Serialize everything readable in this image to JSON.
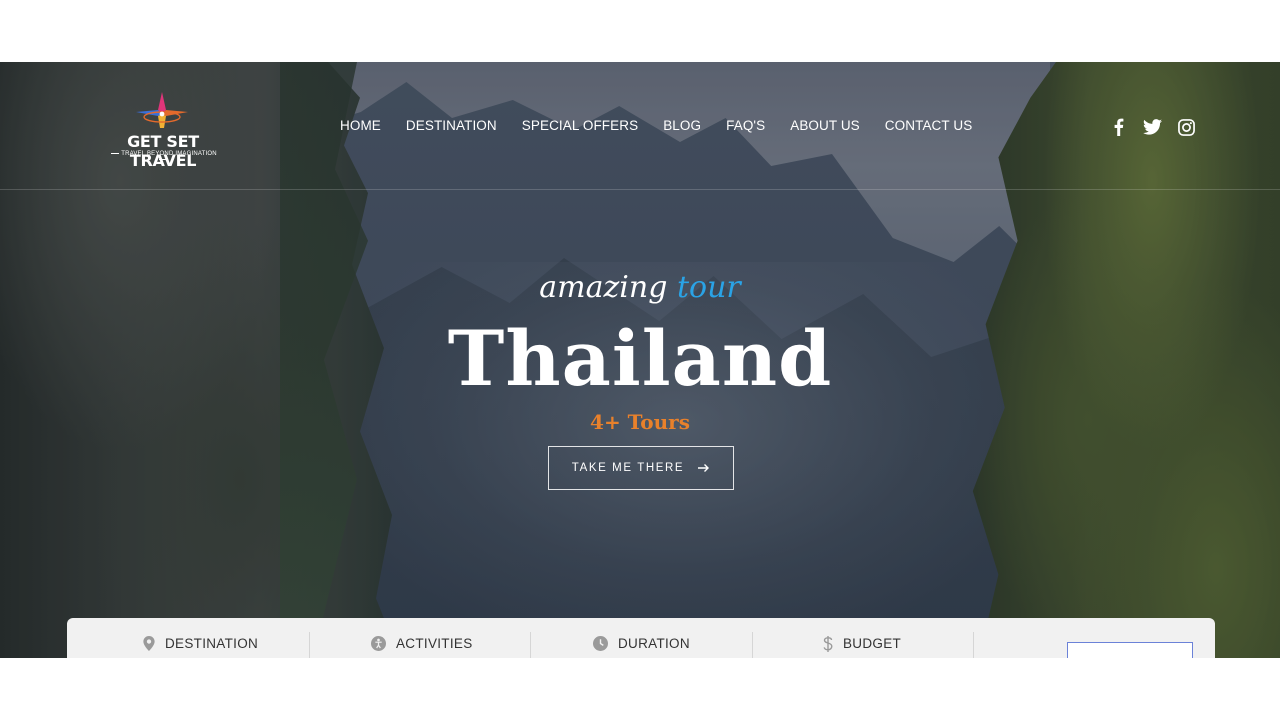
{
  "header": {
    "logo": {
      "title": "GET SET TRAVEL",
      "subtitle": "TRAVEL BEYOND IMAGINATION"
    },
    "nav": [
      {
        "label": "HOME"
      },
      {
        "label": "DESTINATION"
      },
      {
        "label": "SPECIAL OFFERS"
      },
      {
        "label": "BLOG"
      },
      {
        "label": "FAQ'S"
      },
      {
        "label": "ABOUT US"
      },
      {
        "label": "CONTACT US"
      }
    ],
    "social": [
      {
        "icon": "facebook-icon"
      },
      {
        "icon": "twitter-icon"
      },
      {
        "icon": "instagram-icon"
      }
    ]
  },
  "hero": {
    "tagline_word1": "amazing",
    "tagline_word2": "tour",
    "destination": "Thailand",
    "tours_count": "4+ Tours",
    "cta_label": "TAKE ME THERE",
    "cta_icon": "arrow-right-icon"
  },
  "search": {
    "fields": [
      {
        "label": "DESTINATION",
        "icon": "map-pin-icon"
      },
      {
        "label": "ACTIVITIES",
        "icon": "activity-icon"
      },
      {
        "label": "DURATION",
        "icon": "clock-icon"
      },
      {
        "label": "BUDGET",
        "icon": "dollar-icon"
      }
    ]
  },
  "colors": {
    "accent_blue": "#2aa3e6",
    "accent_orange": "#e9812b",
    "panel_bg": "#f1f1f1",
    "button_border": "#6b82d8"
  }
}
